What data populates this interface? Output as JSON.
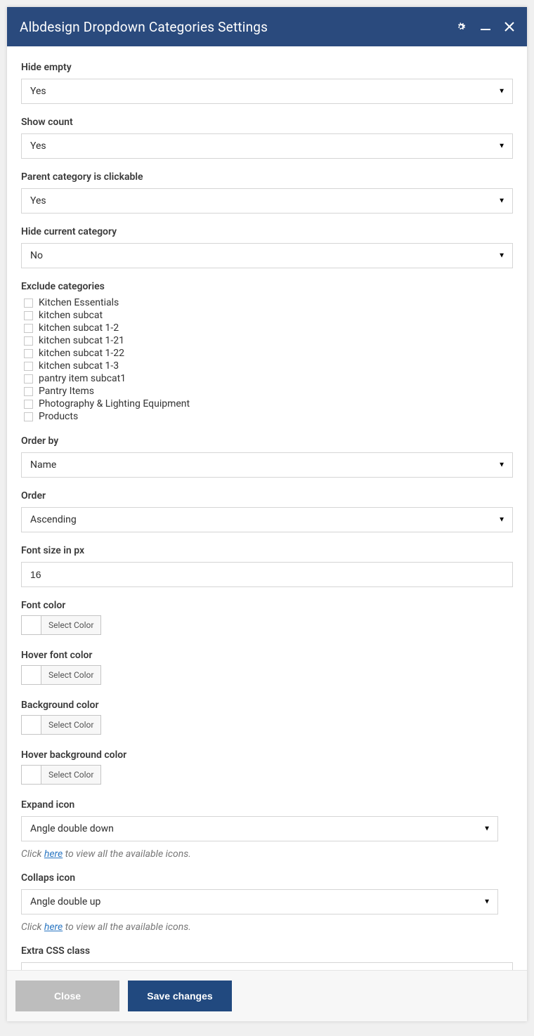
{
  "header": {
    "title": "Albdesign Dropdown Categories Settings"
  },
  "fields": {
    "hide_empty": {
      "label": "Hide empty",
      "value": "Yes"
    },
    "show_count": {
      "label": "Show count",
      "value": "Yes"
    },
    "parent_clickable": {
      "label": "Parent category is clickable",
      "value": "Yes"
    },
    "hide_current": {
      "label": "Hide current category",
      "value": "No"
    },
    "exclude_label": "Exclude categories",
    "exclude_categories": [
      "Kitchen Essentials",
      "kitchen subcat",
      "kitchen subcat 1-2",
      "kitchen subcat 1-21",
      "kitchen subcat 1-22",
      "kitchen subcat 1-3",
      "pantry item subcat1",
      "Pantry Items",
      "Photography & Lighting Equipment",
      "Products"
    ],
    "order_by": {
      "label": "Order by",
      "value": "Name"
    },
    "order": {
      "label": "Order",
      "value": "Ascending"
    },
    "font_size": {
      "label": "Font size in px",
      "value": "16"
    },
    "font_color": {
      "label": "Font color",
      "btn": "Select Color"
    },
    "hover_font_color": {
      "label": "Hover font color",
      "btn": "Select Color"
    },
    "background_color": {
      "label": "Background color",
      "btn": "Select Color"
    },
    "hover_background_color": {
      "label": "Hover background color",
      "btn": "Select Color"
    },
    "expand_icon": {
      "label": "Expand icon",
      "value": "Angle double down"
    },
    "collapse_icon": {
      "label": "Collaps icon",
      "value": "Angle double up"
    },
    "extra_css": {
      "label": "Extra CSS class",
      "value": ""
    },
    "hint_click": "Click ",
    "hint_here": "here",
    "hint_rest": " to view all the available icons."
  },
  "footer": {
    "close": "Close",
    "save": "Save changes"
  }
}
